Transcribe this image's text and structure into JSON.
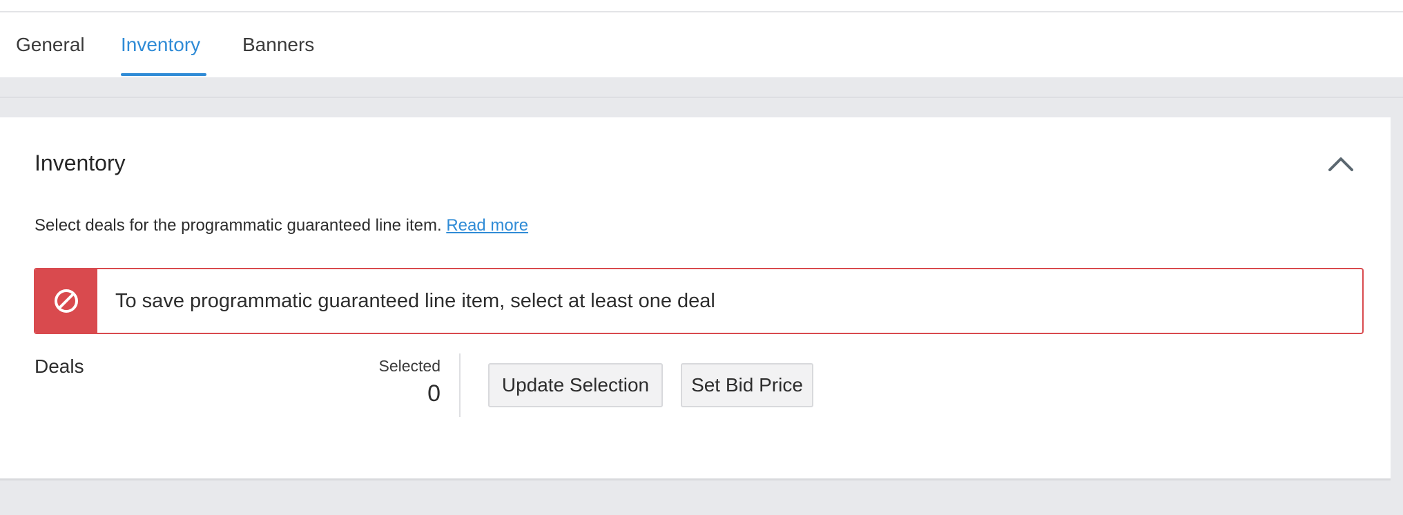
{
  "tabs": [
    {
      "label": "General",
      "active": false
    },
    {
      "label": "Inventory",
      "active": true
    },
    {
      "label": "Banners",
      "active": false
    }
  ],
  "card": {
    "title": "Inventory",
    "collapse_icon": "chevron-up-icon",
    "description": "Select deals for the programmatic guaranteed line item.",
    "read_more_label": "Read more"
  },
  "alert": {
    "icon": "prohibited-icon",
    "message": "To save programmatic guaranteed line item, select at least one deal"
  },
  "deals": {
    "label": "Deals",
    "selected_label": "Selected",
    "selected_count": "0",
    "update_button_label": "Update Selection",
    "bid_button_label": "Set Bid Price"
  },
  "colors": {
    "accent": "#2f8bd6",
    "error": "#d94a4e",
    "background": "#e8e9ec"
  }
}
